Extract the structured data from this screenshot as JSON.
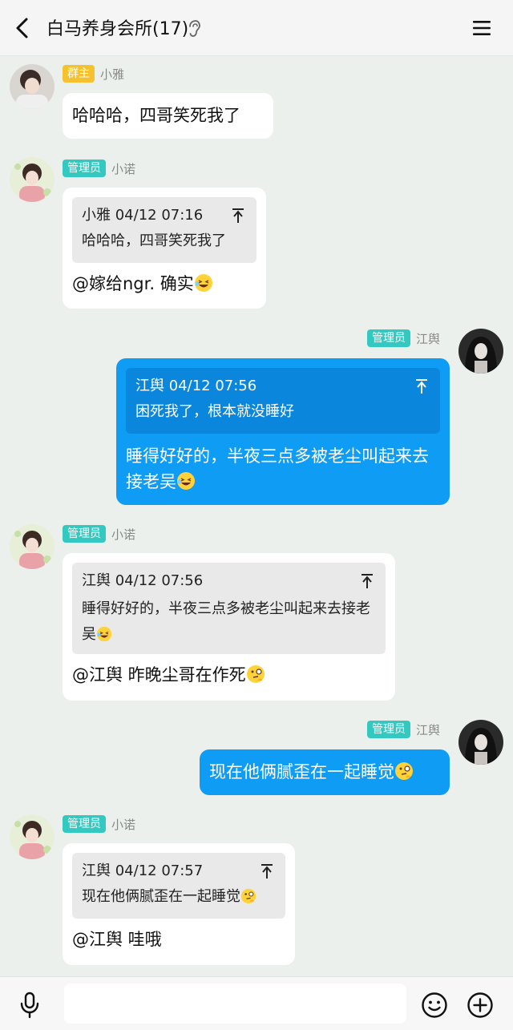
{
  "header": {
    "title": "白马养身会所(17)"
  },
  "messages": [
    {
      "badge": "群主",
      "name": "小雅",
      "text": "哈哈哈，四哥笑死我了"
    },
    {
      "badge": "管理员",
      "name": "小诺",
      "quote": {
        "header": "小雅 04/12 07:16",
        "body": "哈哈哈，四哥笑死我了"
      },
      "text": "@嫁给ngr. 确实"
    },
    {
      "badge": "管理员",
      "name": "江舆",
      "quote": {
        "header": "江舆 04/12 07:56",
        "body": "困死我了，根本就没睡好"
      },
      "text": "睡得好好的，半夜三点多被老尘叫起来去接老吴"
    },
    {
      "badge": "管理员",
      "name": "小诺",
      "quote": {
        "header": "江舆 04/12 07:56",
        "body": "睡得好好的，半夜三点多被老尘叫起来去接老吴"
      },
      "text": "@江舆 昨晚尘哥在作死"
    },
    {
      "badge": "管理员",
      "name": "江舆",
      "text": "现在他俩腻歪在一起睡觉"
    },
    {
      "badge": "管理员",
      "name": "小诺",
      "quote": {
        "header": "江舆 04/12 07:57",
        "body": "现在他俩腻歪在一起睡觉"
      },
      "text": "@江舆 哇哦"
    }
  ],
  "input": {
    "value": "",
    "placeholder": ""
  },
  "icons": {
    "back": "back-arrow-icon",
    "ear": "ear-icon",
    "menu": "menu-icon",
    "quote_jump": "jump-to-top-icon",
    "mic": "microphone-icon",
    "emoji": "smiley-icon",
    "plus": "plus-circle-icon",
    "laugh": "laughing-emoji",
    "think": "thinking-emoji"
  },
  "colors": {
    "own_bubble": "#0f9cf5",
    "owner_badge": "#f5c12e",
    "admin_badge": "#33c9c0",
    "chat_bg": "#ecf0ec"
  }
}
